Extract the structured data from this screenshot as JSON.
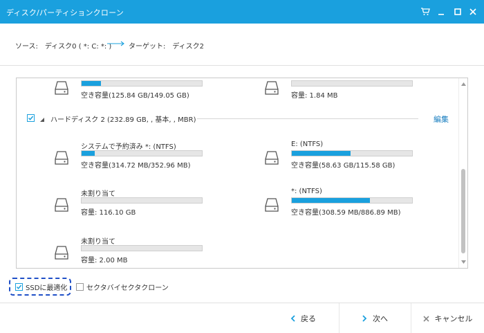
{
  "window": {
    "title": "ディスク/パーティションクローン"
  },
  "path": {
    "source": "ソース:　ディスク0 ( *: C: *: )",
    "target": "ターゲット:　ディスク2"
  },
  "top_partitions": [
    {
      "space": "空き容量(125.84 GB/149.05 GB)",
      "used_fraction": 0.16
    },
    {
      "space": "容量: 1.84 MB",
      "used_fraction": 0.0
    }
  ],
  "disk": {
    "name": "ハードディスク 2 (232.89 GB, , 基本, , MBR)",
    "edit_label": "編集"
  },
  "partitions": [
    {
      "label": "システムで予約済み *: (NTFS)",
      "space": "空き容量(314.72 MB/352.96 MB)",
      "used_fraction": 0.11
    },
    {
      "label": "E: (NTFS)",
      "space": "空き容量(58.63 GB/115.58 GB)",
      "used_fraction": 0.49
    },
    {
      "label": "未割り当て",
      "space": "容量: 116.10 GB",
      "used_fraction": 0.0
    },
    {
      "label": "*: (NTFS)",
      "space": "空き容量(308.59 MB/886.89 MB)",
      "used_fraction": 0.65
    },
    {
      "label": "未割り当て",
      "space": "容量: 2.00 MB",
      "used_fraction": 0.0
    }
  ],
  "options": {
    "ssd_label": "SSDに最適化",
    "ssd_checked": true,
    "sector_label": "セクタバイセクタクローン",
    "sector_checked": false
  },
  "footer": {
    "back_label": "戻る",
    "next_label": "次へ",
    "cancel_label": "キャンセル"
  },
  "colors": {
    "accent": "#1aa0de",
    "bar_bg": "#e6e6e6",
    "link": "#1a7fc0",
    "focus_outline": "#1f4fc7"
  }
}
